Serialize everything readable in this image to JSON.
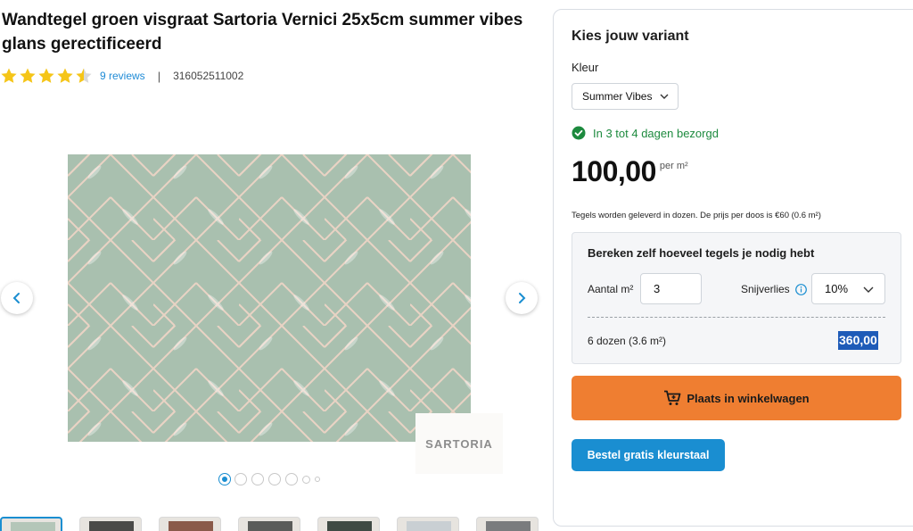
{
  "product": {
    "title": "Wandtegel groen visgraat Sartoria Vernici 25x5cm summer vibes glans gerectificeerd",
    "rating": 4.5,
    "reviews_label": "9 reviews",
    "separator": "|",
    "sku": "316052511002",
    "brand": "SARTORIA",
    "tile_color": "#a8bfae"
  },
  "gallery": {
    "prev_icon": "chevron-left-icon",
    "next_icon": "chevron-right-icon",
    "active_dot": 1,
    "dot_count": 7
  },
  "variant": {
    "title": "Kies jouw variant",
    "color_label": "Kleur",
    "color_value": "Summer Vibes",
    "delivery": "In 3 tot 4 dagen bezorgd",
    "price": "100,00",
    "price_unit": "per m²",
    "note": "Tegels worden geleverd in dozen. De prijs per doos is €60 (0.6 m²)"
  },
  "calculator": {
    "title": "Bereken zelf hoeveel tegels je nodig hebt",
    "aantal_label": "Aantal m²",
    "aantal_value": "3",
    "snijverlies_label": "Snijverlies",
    "snijverlies_value": "10%",
    "dozen": "6 dozen (3.6 m²)",
    "total": "360,00"
  },
  "actions": {
    "cart_label": "Plaats in winkelwagen",
    "sample_label": "Bestel gratis kleurstaal"
  },
  "colors": {
    "accent_blue": "#1a8ed1",
    "cart_orange": "#ef7e31",
    "delivery_green": "#1d8a3e",
    "star_yellow": "#f5c518"
  }
}
